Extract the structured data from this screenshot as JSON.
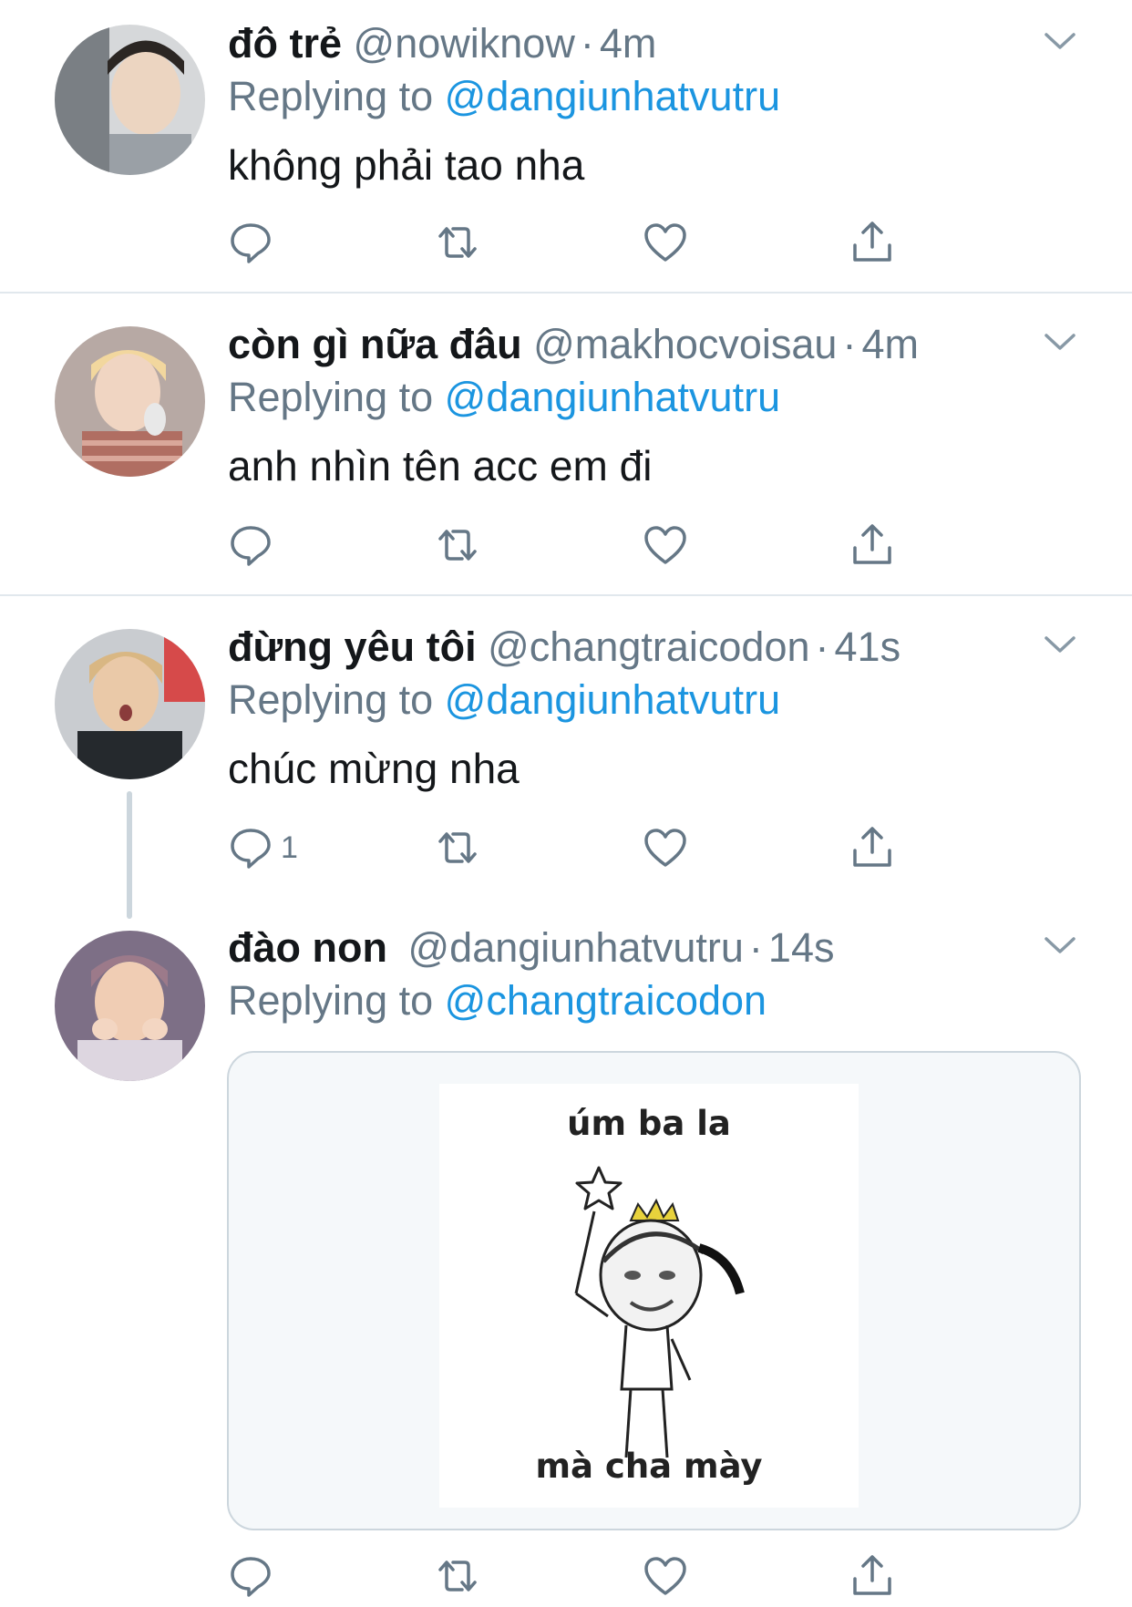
{
  "tweets": [
    {
      "name": "đô trẻ",
      "handle": "@nowiknow",
      "time": "4m",
      "replying_label": "Replying to",
      "replying_to": "@dangiunhatvutru",
      "text": "không phải tao nha",
      "reply_count": "",
      "avatar_colors": [
        "#6b6f73",
        "#e9d6c4"
      ]
    },
    {
      "name": "còn gì nữa đâu",
      "handle": "@makhocvoisau",
      "time": "4m",
      "replying_label": "Replying to",
      "replying_to": "@dangiunhatvutru",
      "text": "anh nhìn tên acc em đi",
      "reply_count": "",
      "avatar_colors": [
        "#c9a99a",
        "#f0d49a"
      ]
    },
    {
      "name": "đừng yêu tôi",
      "handle": "@changtraicodon",
      "time": "41s",
      "replying_label": "Replying to",
      "replying_to": "@dangiunhatvutru",
      "text": "chúc mừng nha",
      "reply_count": "1",
      "avatar_colors": [
        "#2a2e33",
        "#e8c49a"
      ]
    },
    {
      "name": "đào non",
      "handle": "@dangiunhatvutru",
      "time": "14s",
      "replying_label": "Replying to",
      "replying_to": "@changtraicodon",
      "text": "",
      "reply_count": "",
      "avatar_colors": [
        "#8a7e93",
        "#edc7ae"
      ]
    }
  ],
  "meme": {
    "top_text": "úm ba la",
    "bottom_text": "mà cha mày"
  },
  "icons": [
    "reply-icon",
    "retweet-icon",
    "like-icon",
    "share-icon",
    "chevron-down-icon"
  ],
  "colors": {
    "accent": "#1b95e0",
    "muted": "#657786",
    "text": "#14171a",
    "divider": "#e1e8ed"
  }
}
